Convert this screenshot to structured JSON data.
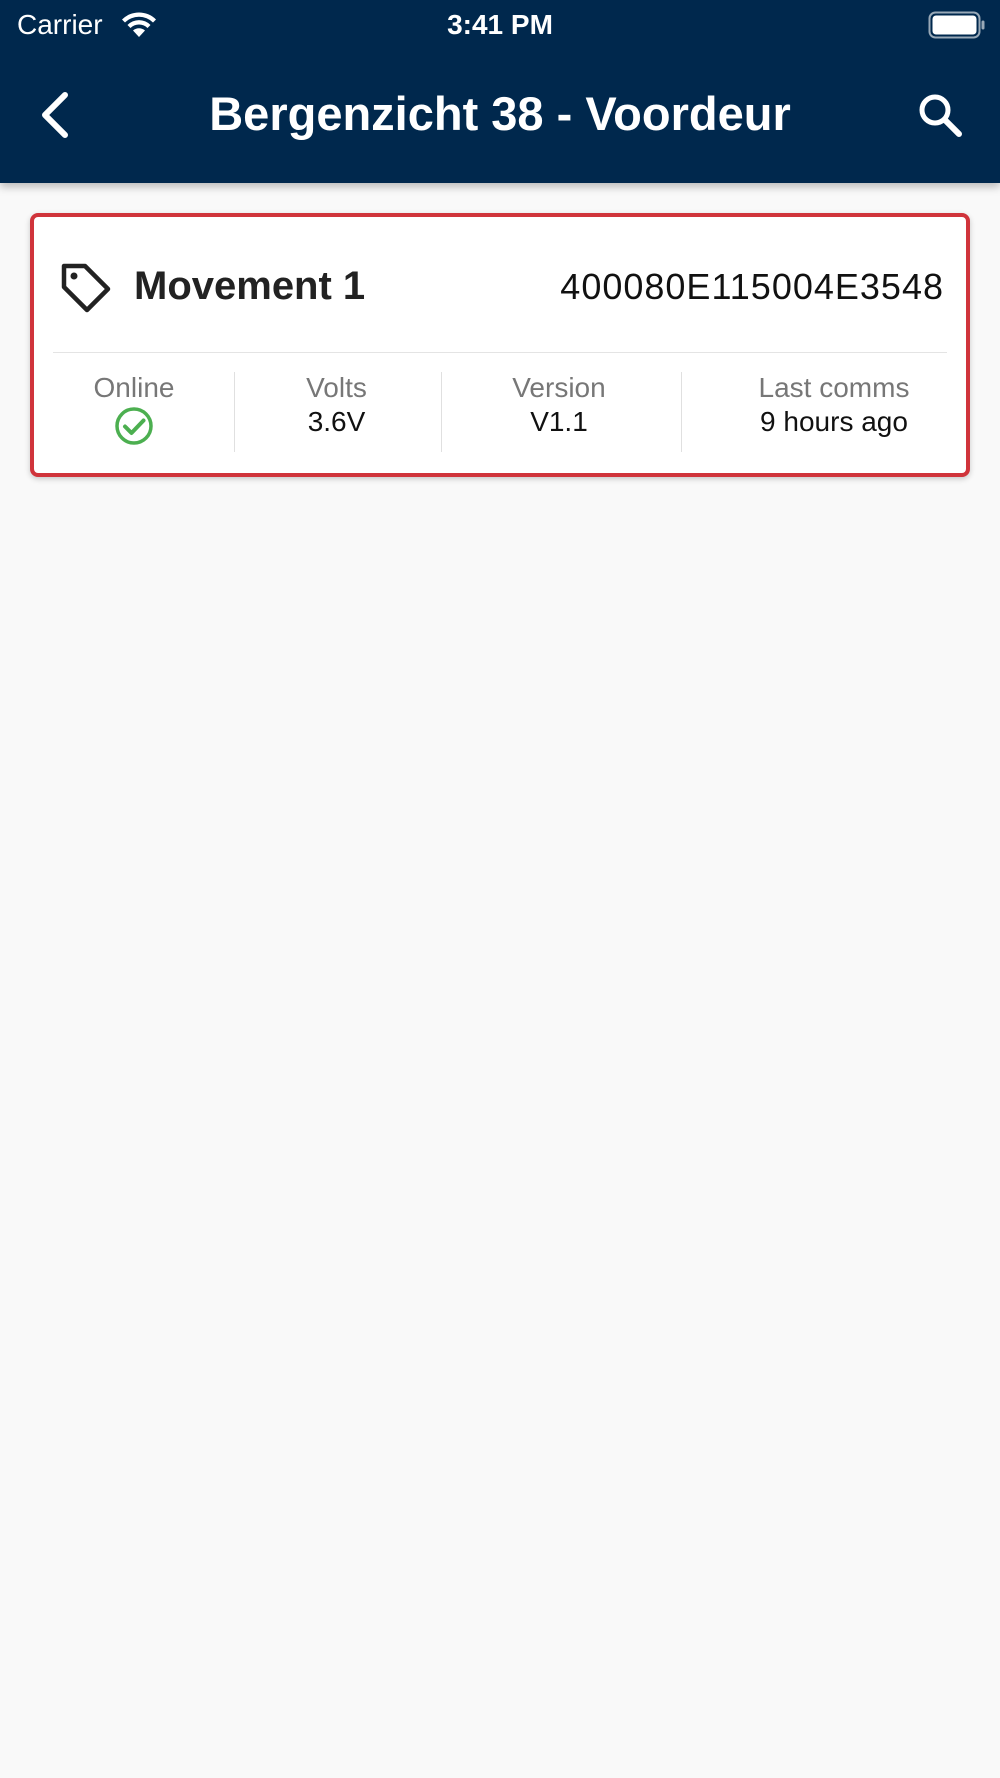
{
  "status_bar": {
    "carrier": "Carrier",
    "time": "3:41 PM",
    "wifi_icon": "wifi-icon",
    "battery_icon": "battery-icon"
  },
  "nav": {
    "title": "Bergenzicht 38 - Voordeur",
    "back_icon": "chevron-left-icon",
    "search_icon": "search-icon",
    "background_color": "#00284d"
  },
  "card": {
    "icon": "tag-icon",
    "title": "Movement 1",
    "device_id": "400080E115004E3548",
    "border_color": "#d0343b",
    "stats": [
      {
        "label": "Online",
        "status_icon": "check-circle-icon",
        "status_color": "#4caf50"
      },
      {
        "label": "Volts",
        "value": "3.6V"
      },
      {
        "label": "Version",
        "value": "V1.1"
      },
      {
        "label": "Last comms",
        "value": "9 hours ago"
      }
    ]
  }
}
